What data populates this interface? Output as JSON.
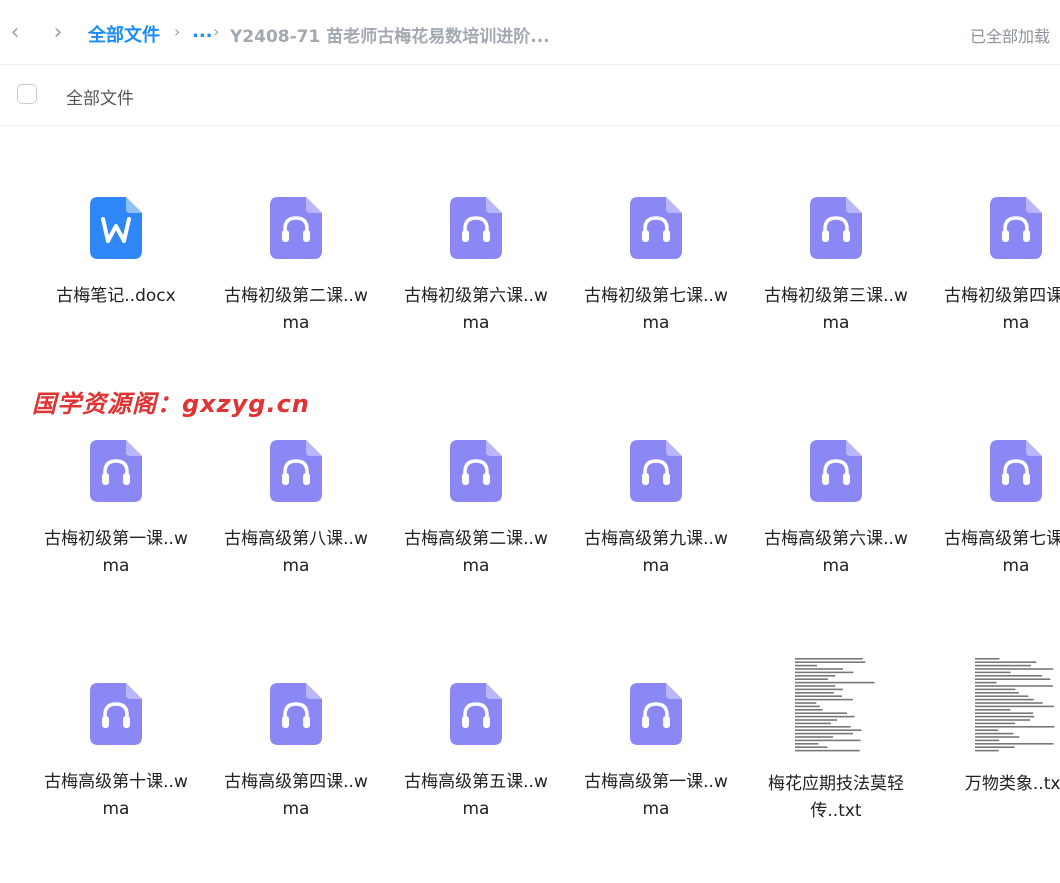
{
  "header": {
    "breadcrumb_root": "全部文件",
    "breadcrumb_ellipsis": "...",
    "breadcrumb_current": "Y2408-71 苗老师古梅花易数培训进阶...",
    "load_status": "已全部加载"
  },
  "toolbar": {
    "select_all_label": "全部文件"
  },
  "watermark": "国学资源阁：gxzyg.cn",
  "colors": {
    "accent": "#1a8cff",
    "audio_icon": "#8b87f5",
    "word_icon": "#2f86f6",
    "watermark": "#e03333"
  },
  "files": [
    {
      "name": "古梅笔记..docx",
      "icon": "word-doc-icon"
    },
    {
      "name": "古梅初级第二课..wma",
      "icon": "audio-file-icon"
    },
    {
      "name": "古梅初级第六课..wma",
      "icon": "audio-file-icon"
    },
    {
      "name": "古梅初级第七课..wma",
      "icon": "audio-file-icon"
    },
    {
      "name": "古梅初级第三课..wma",
      "icon": "audio-file-icon"
    },
    {
      "name": "古梅初级第四课..wma",
      "icon": "audio-file-icon"
    },
    {
      "name": "古梅初级第一课..wma",
      "icon": "audio-file-icon"
    },
    {
      "name": "古梅高级第八课..wma",
      "icon": "audio-file-icon"
    },
    {
      "name": "古梅高级第二课..wma",
      "icon": "audio-file-icon"
    },
    {
      "name": "古梅高级第九课..wma",
      "icon": "audio-file-icon"
    },
    {
      "name": "古梅高级第六课..wma",
      "icon": "audio-file-icon"
    },
    {
      "name": "古梅高级第七课..wma",
      "icon": "audio-file-icon"
    },
    {
      "name": "古梅高级第十课..wma",
      "icon": "audio-file-icon"
    },
    {
      "name": "古梅高级第四课..wma",
      "icon": "audio-file-icon"
    },
    {
      "name": "古梅高级第五课..wma",
      "icon": "audio-file-icon"
    },
    {
      "name": "古梅高级第一课..wma",
      "icon": "audio-file-icon"
    },
    {
      "name": "梅花应期技法莫轻传..txt",
      "icon": "text-thumbnail-icon"
    },
    {
      "name": "万物类象..txt",
      "icon": "text-thumbnail-icon"
    }
  ]
}
